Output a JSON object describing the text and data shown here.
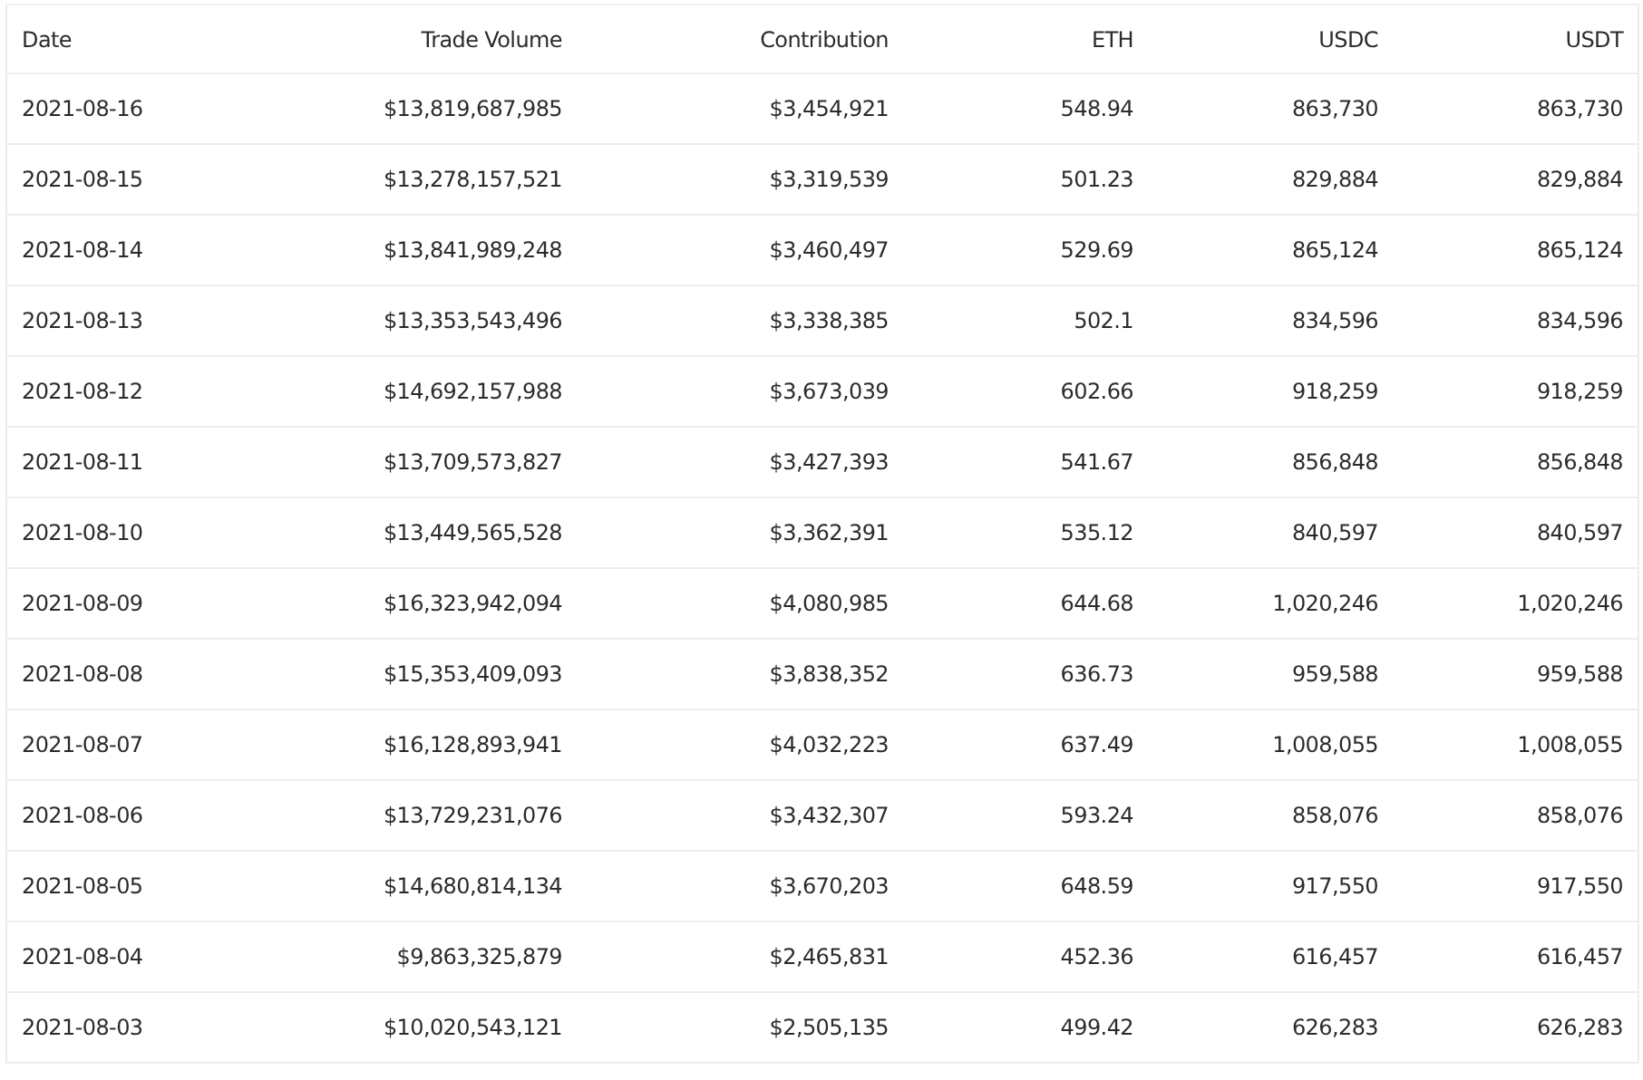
{
  "table": {
    "columns": [
      "Date",
      "Trade Volume",
      "Contribution",
      "ETH",
      "USDC",
      "USDT"
    ],
    "rows": [
      [
        "2021-08-16",
        "$13,819,687,985",
        "$3,454,921",
        "548.94",
        "863,730",
        "863,730"
      ],
      [
        "2021-08-15",
        "$13,278,157,521",
        "$3,319,539",
        "501.23",
        "829,884",
        "829,884"
      ],
      [
        "2021-08-14",
        "$13,841,989,248",
        "$3,460,497",
        "529.69",
        "865,124",
        "865,124"
      ],
      [
        "2021-08-13",
        "$13,353,543,496",
        "$3,338,385",
        "502.1",
        "834,596",
        "834,596"
      ],
      [
        "2021-08-12",
        "$14,692,157,988",
        "$3,673,039",
        "602.66",
        "918,259",
        "918,259"
      ],
      [
        "2021-08-11",
        "$13,709,573,827",
        "$3,427,393",
        "541.67",
        "856,848",
        "856,848"
      ],
      [
        "2021-08-10",
        "$13,449,565,528",
        "$3,362,391",
        "535.12",
        "840,597",
        "840,597"
      ],
      [
        "2021-08-09",
        "$16,323,942,094",
        "$4,080,985",
        "644.68",
        "1,020,246",
        "1,020,246"
      ],
      [
        "2021-08-08",
        "$15,353,409,093",
        "$3,838,352",
        "636.73",
        "959,588",
        "959,588"
      ],
      [
        "2021-08-07",
        "$16,128,893,941",
        "$4,032,223",
        "637.49",
        "1,008,055",
        "1,008,055"
      ],
      [
        "2021-08-06",
        "$13,729,231,076",
        "$3,432,307",
        "593.24",
        "858,076",
        "858,076"
      ],
      [
        "2021-08-05",
        "$14,680,814,134",
        "$3,670,203",
        "648.59",
        "917,550",
        "917,550"
      ],
      [
        "2021-08-04",
        "$9,863,325,879",
        "$2,465,831",
        "452.36",
        "616,457",
        "616,457"
      ],
      [
        "2021-08-03",
        "$10,020,543,121",
        "$2,505,135",
        "499.42",
        "626,283",
        "626,283"
      ]
    ]
  }
}
